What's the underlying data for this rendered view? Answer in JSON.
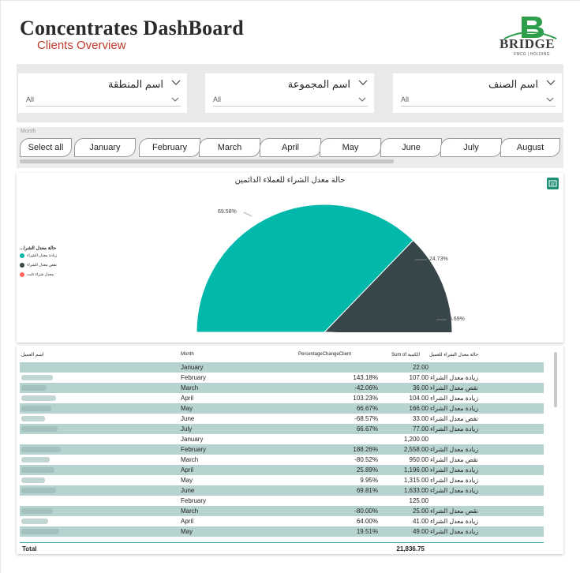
{
  "header": {
    "title": "Concentrates DashBoard",
    "subtitle": "Clients Overview",
    "logo_name": "BRIDGE",
    "logo_tagline": "FMCG | HOLDING",
    "logo_color": "#2e9e4a"
  },
  "filters": [
    {
      "label": "اسم المنطقة",
      "value": "All"
    },
    {
      "label": "اسم المجموعة",
      "value": "All"
    },
    {
      "label": "اسم الصنف",
      "value": "All"
    }
  ],
  "month_slicer": {
    "caption": "Month",
    "options": [
      "Select all",
      "January",
      "February",
      "March",
      "April",
      "May",
      "June",
      "July",
      "August"
    ]
  },
  "chart": {
    "focus_icon": "focus-mode-icon"
  },
  "chart_data": {
    "type": "pie",
    "title": "حالة معدل الشراء للعملاء الدائمين",
    "legend_title": "حالة معدل الشرا...",
    "legend_placement": "left",
    "slices": [
      {
        "name": "زيادة معدل الشراء",
        "value": 69.58,
        "label": "69.58%",
        "color": "#01b8aa"
      },
      {
        "name": "نقص معدل الشراء",
        "value": 24.73,
        "label": "24.73%",
        "color": "#374649"
      },
      {
        "name": "معدل شراء ثابت",
        "value": 5.69,
        "label": "5.69%",
        "color": "#fd625e"
      }
    ]
  },
  "table": {
    "columns": [
      "اسم العميل",
      "Month",
      "PercentageChangeClient",
      "Sum of الكمية",
      "حالة معدل الشراء للعميل"
    ],
    "rows": [
      {
        "month": "January",
        "pct": "",
        "sum": "22.00",
        "status": ""
      },
      {
        "month": "February",
        "pct": "143.18%",
        "sum": "107.00",
        "status": "زيادة معدل الشراء"
      },
      {
        "month": "March",
        "pct": "-42.06%",
        "sum": "36.00",
        "status": "نقص معدل الشراء"
      },
      {
        "month": "April",
        "pct": "103.23%",
        "sum": "104.00",
        "status": "زيادة معدل الشراء"
      },
      {
        "month": "May",
        "pct": "66.67%",
        "sum": "166.00",
        "status": "زيادة معدل الشراء"
      },
      {
        "month": "June",
        "pct": "-68.57%",
        "sum": "33.00",
        "status": "نقص معدل الشراء"
      },
      {
        "month": "July",
        "pct": "66.67%",
        "sum": "77.00",
        "status": "زيادة معدل الشراء"
      },
      {
        "month": "January",
        "pct": "",
        "sum": "1,200.00",
        "status": ""
      },
      {
        "month": "February",
        "pct": "188.26%",
        "sum": "2,558.00",
        "status": "زيادة معدل الشراء"
      },
      {
        "month": "March",
        "pct": "-80.52%",
        "sum": "950.00",
        "status": "نقص معدل الشراء"
      },
      {
        "month": "April",
        "pct": "25.89%",
        "sum": "1,196.00",
        "status": "زيادة معدل الشراء"
      },
      {
        "month": "May",
        "pct": "9.95%",
        "sum": "1,315.00",
        "status": "زيادة معدل الشراء"
      },
      {
        "month": "June",
        "pct": "69.81%",
        "sum": "1,633.00",
        "status": "زيادة معدل الشراء"
      },
      {
        "month": "February",
        "pct": "",
        "sum": "125.00",
        "status": ""
      },
      {
        "month": "March",
        "pct": "-80.00%",
        "sum": "25.00",
        "status": "نقص معدل الشراء"
      },
      {
        "month": "April",
        "pct": "64.00%",
        "sum": "41.00",
        "status": "زيادة معدل الشراء"
      },
      {
        "month": "May",
        "pct": "19.51%",
        "sum": "49.00",
        "status": "زيادة معدل الشراء"
      }
    ],
    "total_label": "Total",
    "total_value": "21,836.75"
  }
}
